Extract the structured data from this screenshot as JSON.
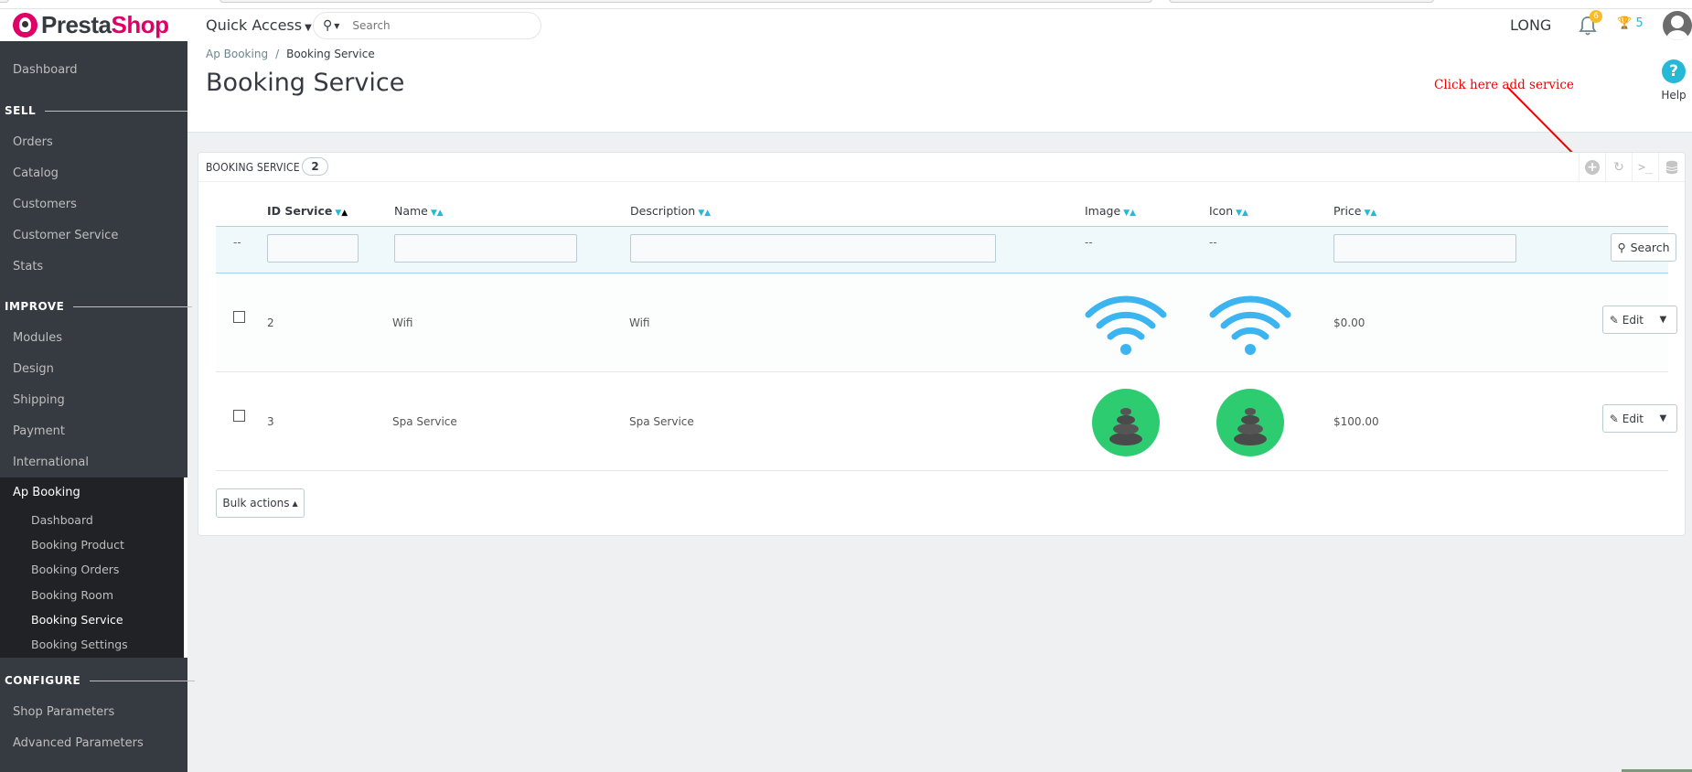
{
  "brand": {
    "part1": "Presta",
    "part2": "Shop"
  },
  "header": {
    "quick_access": "Quick Access",
    "search_placeholder": "Search",
    "shop_name": "LONG",
    "notifications_count": "6",
    "trophy_count": "5"
  },
  "sidebar": {
    "dashboard": "Dashboard",
    "sell_label": "SELL",
    "sell_items": [
      "Orders",
      "Catalog",
      "Customers",
      "Customer Service",
      "Stats"
    ],
    "improve_label": "IMPROVE",
    "improve_items": [
      "Modules",
      "Design",
      "Shipping",
      "Payment",
      "International"
    ],
    "ap_booking": "Ap Booking",
    "ap_booking_sub": [
      "Dashboard",
      "Booking Product",
      "Booking Orders",
      "Booking Room",
      "Booking Service",
      "Booking Settings"
    ],
    "configure_label": "CONFIGURE",
    "configure_items": [
      "Shop Parameters",
      "Advanced Parameters"
    ]
  },
  "page": {
    "breadcrumb_parent": "Ap Booking",
    "breadcrumb_current": "Booking Service",
    "title": "Booking Service",
    "help_label": "Help",
    "annotation": "Click here add service"
  },
  "panel": {
    "title": "BOOKING SERVICE",
    "count": "2",
    "columns": {
      "id": "ID Service",
      "name": "Name",
      "description": "Description",
      "image": "Image",
      "icon": "Icon",
      "price": "Price"
    },
    "filter_dash": "--",
    "search_button": "Search",
    "rows": [
      {
        "id": "2",
        "name": "Wifi",
        "description": "Wifi",
        "price": "$0.00",
        "image": "wifi-icon"
      },
      {
        "id": "3",
        "name": "Spa Service",
        "description": "Spa Service",
        "price": "$100.00",
        "image": "spa-stones-icon"
      }
    ],
    "edit_label": "Edit",
    "bulk_actions": "Bulk actions"
  },
  "colors": {
    "brand": "#df0067",
    "accent": "#25b9d7",
    "sidebar": "#363a41",
    "annotation": "#ee0000"
  }
}
